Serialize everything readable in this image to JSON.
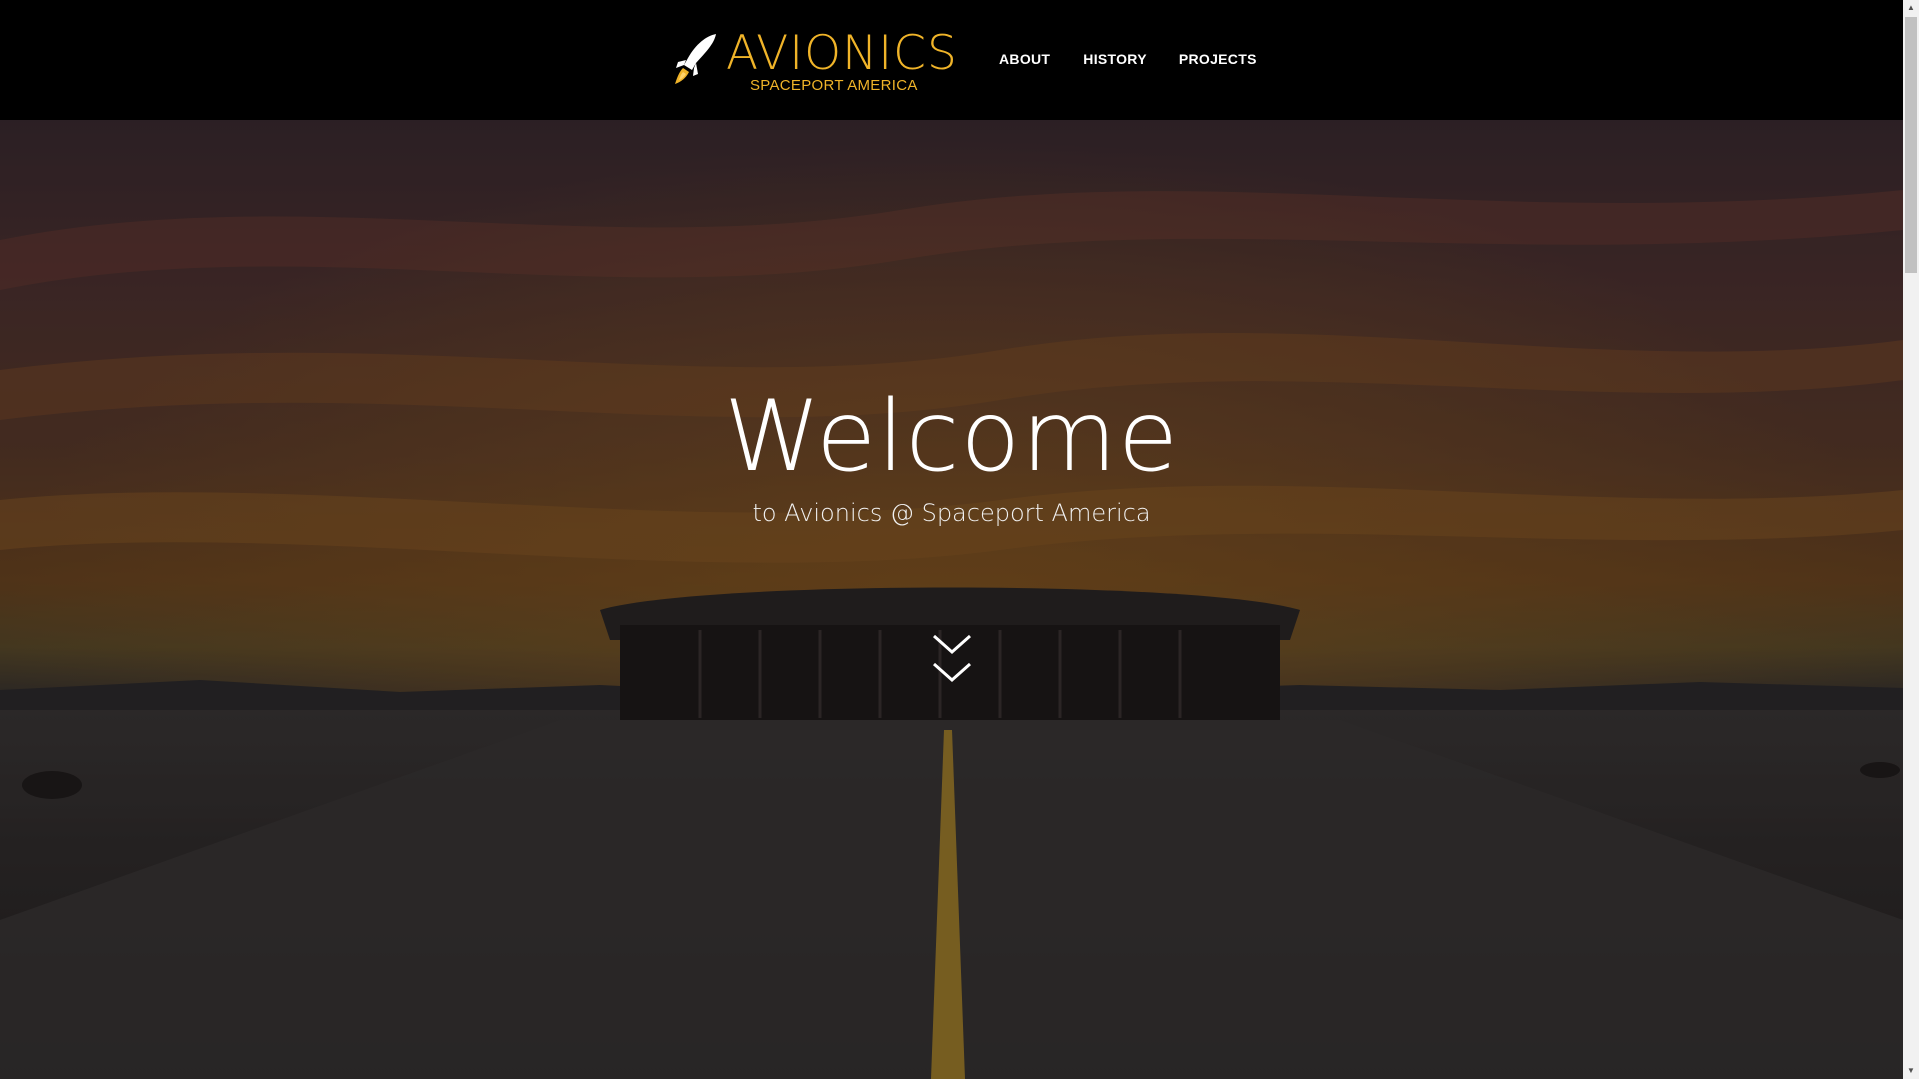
{
  "brand": {
    "title": "AVIONICS",
    "subtitle": "SPACEPORT AMERICA",
    "icon": "rocket-icon",
    "color": "#f0b429"
  },
  "nav": {
    "items": [
      {
        "label": "ABOUT"
      },
      {
        "label": "HISTORY"
      },
      {
        "label": "PROJECTS"
      }
    ]
  },
  "hero": {
    "title": "Welcome",
    "subtitle": "to Avionics @ Spaceport America",
    "scroll_icon": "double-chevron-down-icon"
  },
  "colors": {
    "header_bg": "#000000",
    "accent": "#f0b429",
    "text": "#ffffff"
  }
}
